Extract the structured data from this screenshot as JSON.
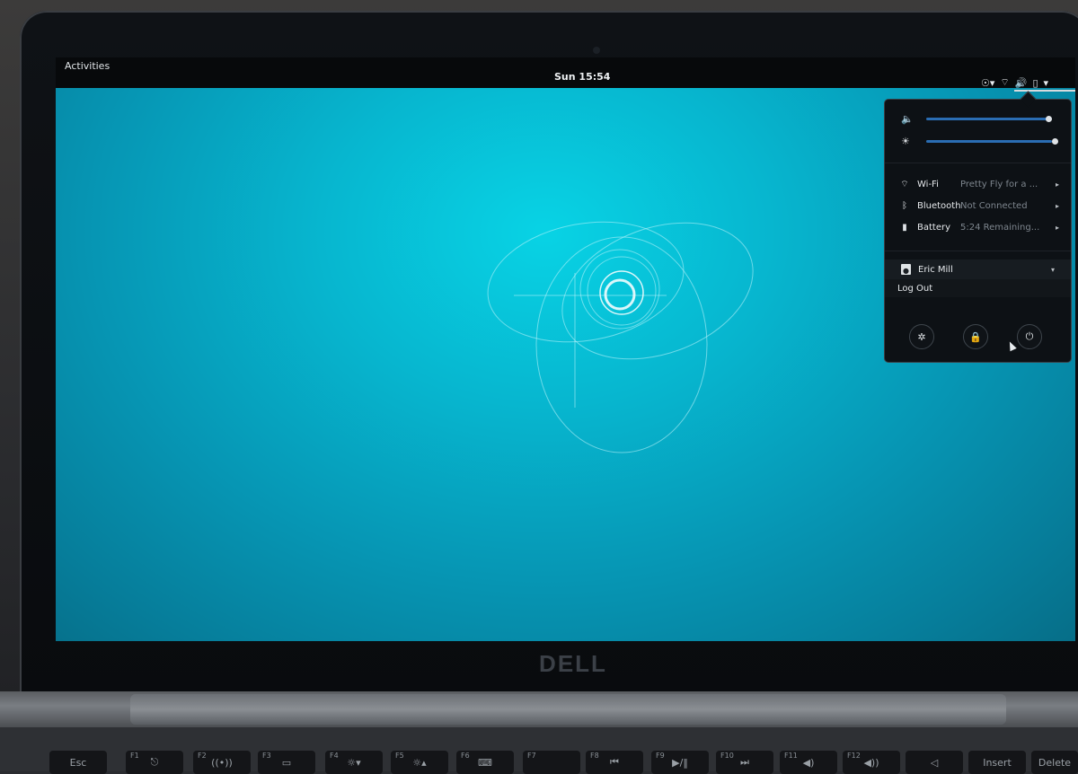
{
  "topbar": {
    "activities": "Activities",
    "clock": "Sun 15:54"
  },
  "menu": {
    "volume_level": 0.95,
    "brightness_level": 1.0,
    "wifi": {
      "label": "Wi-Fi",
      "value": "Pretty Fly for a ..."
    },
    "bluetooth": {
      "label": "Bluetooth",
      "value": "Not Connected"
    },
    "battery": {
      "label": "Battery",
      "value": "5:24 Remaining..."
    },
    "user": {
      "name": "Eric Mill"
    },
    "logout": "Log Out"
  },
  "hardware": {
    "brand": "DELL",
    "keys": [
      {
        "fn": "",
        "label": "Esc"
      },
      {
        "fn": "F1",
        "label": "⎋"
      },
      {
        "fn": "F2",
        "label": "((•))"
      },
      {
        "fn": "F3",
        "label": "▭"
      },
      {
        "fn": "F4",
        "label": "☼▾"
      },
      {
        "fn": "F5",
        "label": "☼▴"
      },
      {
        "fn": "F6",
        "label": "⌨"
      },
      {
        "fn": "F7",
        "label": ""
      },
      {
        "fn": "F8",
        "label": "⏮"
      },
      {
        "fn": "F9",
        "label": "▶/‖"
      },
      {
        "fn": "F10",
        "label": "⏭"
      },
      {
        "fn": "F11",
        "label": "◀)"
      },
      {
        "fn": "F12",
        "label": "◀))"
      },
      {
        "fn": "",
        "label": "◁"
      },
      {
        "fn": "",
        "label": "Insert"
      },
      {
        "fn": "",
        "label": "Delete"
      }
    ]
  },
  "colors": {
    "wallpaper": "#07b6cf",
    "panel": "#07090b",
    "accent": "#2a6db3"
  }
}
